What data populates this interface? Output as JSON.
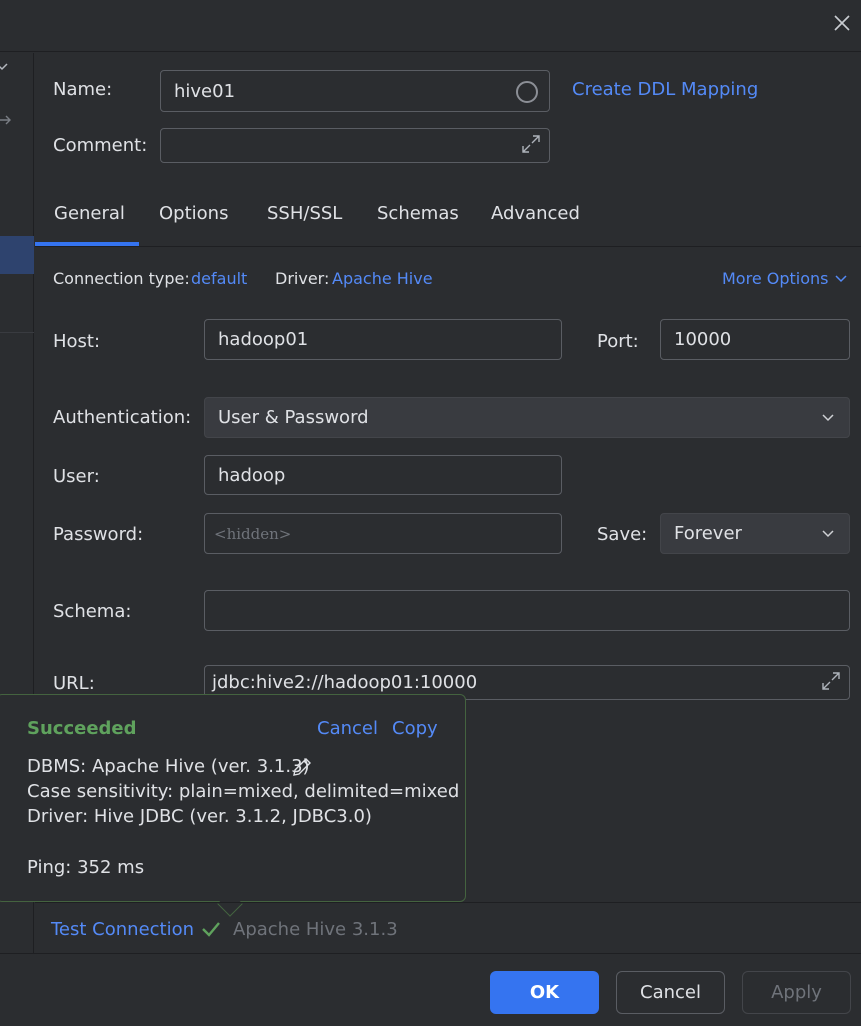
{
  "form": {
    "name_label": "Name:",
    "name_value": "hive01",
    "create_ddl_mapping": "Create DDL Mapping",
    "comment_label": "Comment:",
    "comment_value": ""
  },
  "tabs": [
    "General",
    "Options",
    "SSH/SSL",
    "Schemas",
    "Advanced"
  ],
  "active_tab": "General",
  "general": {
    "connection_type_label": "Connection type:",
    "connection_type_value": "default",
    "driver_label": "Driver:",
    "driver_value": "Apache Hive",
    "more_options": "More Options",
    "host_label": "Host:",
    "host_value": "hadoop01",
    "port_label": "Port:",
    "port_value": "10000",
    "auth_label": "Authentication:",
    "auth_value": "User & Password",
    "user_label": "User:",
    "user_value": "hadoop",
    "password_label": "Password:",
    "password_placeholder": "<hidden>",
    "save_label": "Save:",
    "save_value": "Forever",
    "schema_label": "Schema:",
    "schema_value": "",
    "url_label": "URL:",
    "url_value": "jdbc:hive2://hadoop01:10000"
  },
  "popup": {
    "status": "Succeeded",
    "cancel": "Cancel",
    "copy": "Copy",
    "dbms": "DBMS: Apache Hive (ver. 3.1.3)",
    "case_sensitivity": "Case sensitivity: plain=mixed, delimited=mixed",
    "driver": "Driver: Hive JDBC (ver. 3.1.2, JDBC3.0)",
    "ping": "Ping: 352 ms"
  },
  "test": {
    "label": "Test Connection",
    "result": "Apache Hive 3.1.3"
  },
  "buttons": {
    "ok": "OK",
    "cancel": "Cancel",
    "apply": "Apply"
  },
  "colors": {
    "accent": "#3574f0",
    "link": "#548af7",
    "success": "#5fa25d",
    "background": "#2b2d30"
  }
}
